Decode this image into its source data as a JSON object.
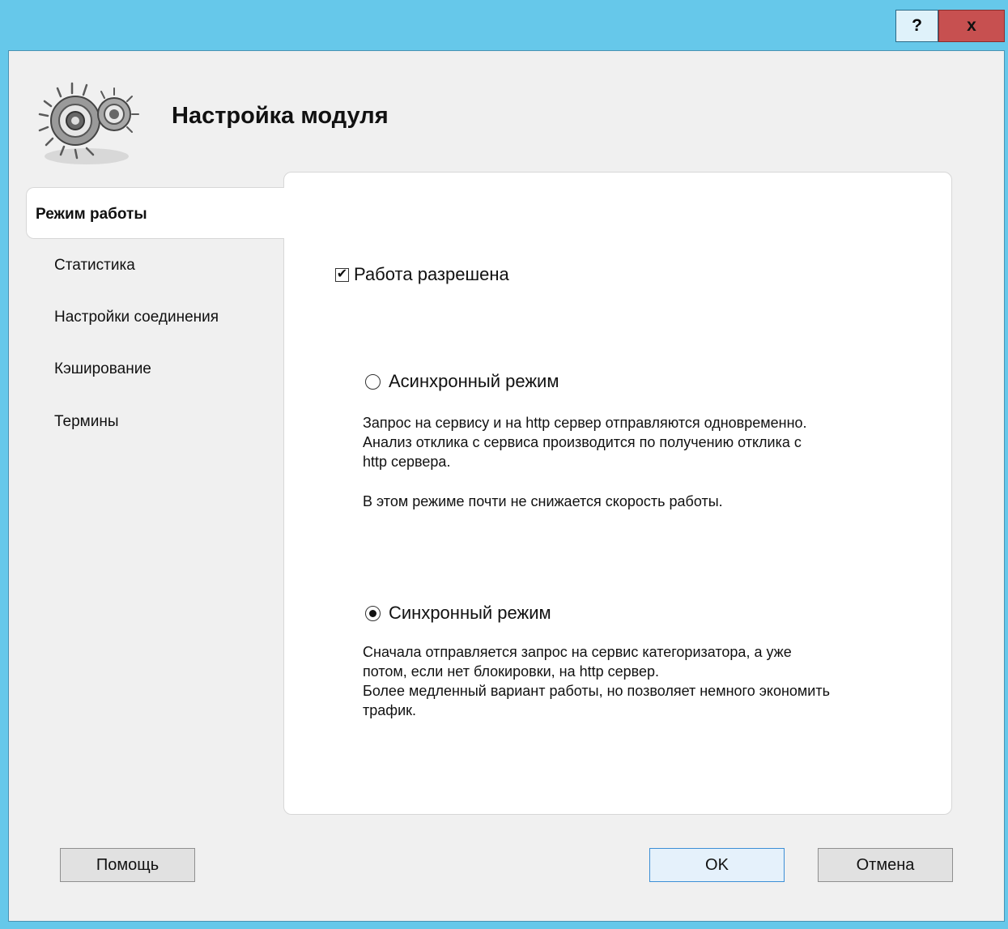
{
  "titlebar": {
    "help_label": "?",
    "close_label": "x",
    "accent_color": "#66c8ea"
  },
  "header": {
    "title": "Настройка модуля",
    "logo_icon": "gears-icon"
  },
  "nav": {
    "items": [
      {
        "label": "Режим работы",
        "active": true
      },
      {
        "label": "Статистика",
        "active": false
      },
      {
        "label": "Настройки соединения",
        "active": false
      },
      {
        "label": "Кэширование",
        "active": false
      },
      {
        "label": "Термины",
        "active": false
      }
    ]
  },
  "panel": {
    "enabled_checkbox": {
      "label": "Работа разрешена",
      "checked": true
    },
    "async_mode": {
      "label": "Асинхронный режим",
      "selected": false,
      "desc_lines": [
        "Запрос на сервису и на http сервер отправляются одновременно.",
        "Анализ отклика с сервиса производится по получению отклика с",
        "http сервера."
      ],
      "desc_note": "В этом режиме почти не снижается скорость работы."
    },
    "sync_mode": {
      "label": "Синхронный режим",
      "selected": true,
      "desc_lines": [
        "Сначала отправляется запрос на сервис категоризатора, а уже",
        "потом, если нет блокировки, на http сервер.",
        "Более медленный вариант работы, но позволяет немного экономить",
        "трафик."
      ]
    }
  },
  "buttons": {
    "help": "Помощь",
    "ok": "OK",
    "cancel": "Отмена"
  }
}
